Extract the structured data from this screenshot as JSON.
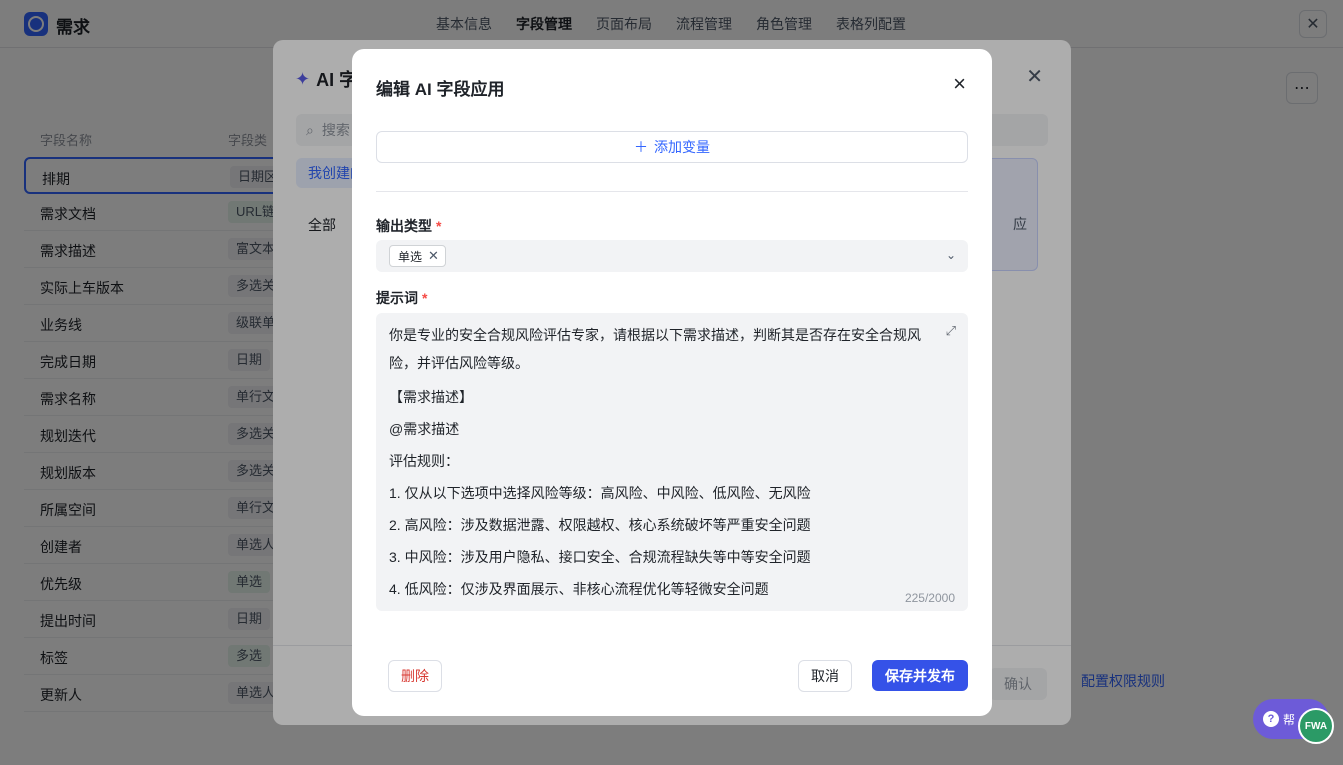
{
  "app": {
    "title": "需求"
  },
  "top_tabs": [
    "基本信息",
    "字段管理",
    "页面布局",
    "流程管理",
    "角色管理",
    "表格列配置"
  ],
  "field_table": {
    "headers": {
      "name": "字段名称",
      "type": "字段类"
    },
    "rows": [
      {
        "name": "排期",
        "type": "日期区"
      },
      {
        "name": "需求文档",
        "type": "URL链"
      },
      {
        "name": "需求描述",
        "type": "富文本"
      },
      {
        "name": "实际上车版本",
        "type": "多选关"
      },
      {
        "name": "业务线",
        "type": "级联单"
      },
      {
        "name": "完成日期",
        "type": "日期"
      },
      {
        "name": "需求名称",
        "type": "单行文"
      },
      {
        "name": "规划迭代",
        "type": "多选关"
      },
      {
        "name": "规划版本",
        "type": "多选关"
      },
      {
        "name": "所属空间",
        "type": "单行文"
      },
      {
        "name": "创建者",
        "type": "单选人"
      },
      {
        "name": "优先级",
        "type": "单选"
      },
      {
        "name": "提出时间",
        "type": "日期"
      },
      {
        "name": "标签",
        "type": "多选"
      },
      {
        "name": "更新人",
        "type": "单选人"
      }
    ]
  },
  "right_panel": {
    "link": "配置权限规则"
  },
  "ai_dialog": {
    "title": "AI 字",
    "search_placeholder": "搜索",
    "tab_mine": "我创建的",
    "tab_all": "全部",
    "card_text": "应",
    "confirm": "确认"
  },
  "modal": {
    "title": "编辑 AI 字段应用",
    "add_variable": "添加变量",
    "output_type_label": "输出类型",
    "output_type_value": "单选",
    "prompt_label": "提示词",
    "prompt_lines": [
      "你是专业的安全合规风险评估专家，请根据以下需求描述，判断其是否存在安全合规风险，并评估风险等级。",
      "【需求描述】",
      "@需求描述",
      "评估规则：",
      "1. 仅从以下选项中选择风险等级：高风险、中风险、低风险、无风险",
      "2. 高风险：涉及数据泄露、权限越权、核心系统破坏等严重安全问题",
      "3. 中风险：涉及用户隐私、接口安全、合规流程缺失等中等安全问题",
      "4. 低风险：仅涉及界面展示、非核心流程优化等轻微安全问题"
    ],
    "char_count": "225/2000",
    "delete_label": "删除",
    "cancel_label": "取消",
    "save_label": "保存并发布"
  },
  "help": {
    "label": "帮",
    "badge": "FWA"
  }
}
